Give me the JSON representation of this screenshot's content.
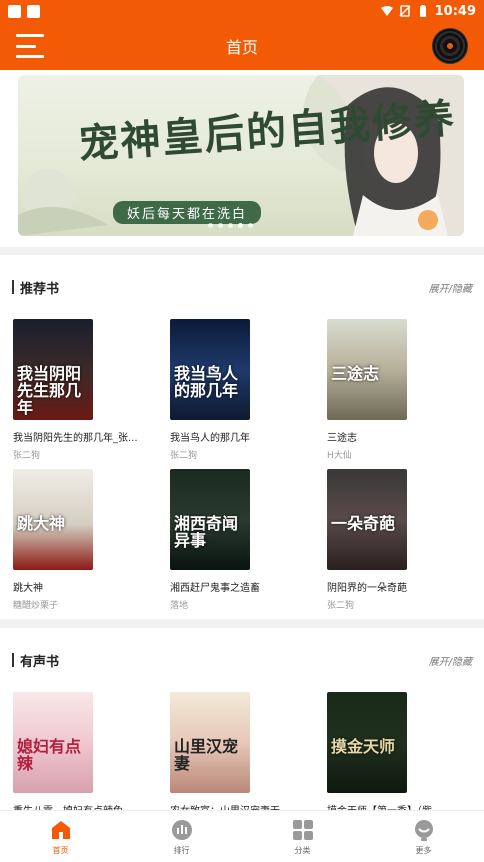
{
  "status_bar": {
    "time": "10:49"
  },
  "app_bar": {
    "title": "首页"
  },
  "banner": {
    "title": "宠神皇后的自我修养",
    "subtitle": "妖后每天都在洗白"
  },
  "sections": [
    {
      "title": "推荐书",
      "toggle": "展开/隐藏",
      "books": [
        {
          "title": "我当阴阳先生的那几年_张...",
          "author": "张二狗",
          "cover_text": "我当阴阳先生那几年"
        },
        {
          "title": "我当鸟人的那几年",
          "author": "张二狗",
          "cover_text": "我当鸟人的那几年"
        },
        {
          "title": "三途志",
          "author": "H大仙",
          "cover_text": "三途志"
        },
        {
          "title": "跳大神",
          "author": "糖醋炒栗子",
          "cover_text": "跳大神"
        },
        {
          "title": "湘西赶尸鬼事之造畜",
          "author": "落地",
          "cover_text": "湘西奇闻异事"
        },
        {
          "title": "阴阳界的一朵奇葩",
          "author": "张二狗",
          "cover_text": "一朵奇葩"
        }
      ]
    },
    {
      "title": "有声书",
      "toggle": "展开/隐藏",
      "books": [
        {
          "title": "重生八零，媳妇有点辣兔",
          "author": "",
          "cover_text": "媳妇有点辣"
        },
        {
          "title": "农女致富：山里汉宠妻无...",
          "author": "",
          "cover_text": "山里汉宠妻"
        },
        {
          "title": "摸金天师【第一季】（紫...",
          "author": "",
          "cover_text": "摸金天师"
        }
      ]
    }
  ],
  "bottom_nav": [
    {
      "label": "首页",
      "icon": "home-icon",
      "active": true
    },
    {
      "label": "排行",
      "icon": "ranking-icon",
      "active": false
    },
    {
      "label": "分类",
      "icon": "category-icon",
      "active": false
    },
    {
      "label": "更多",
      "icon": "more-icon",
      "active": false
    }
  ],
  "colors": {
    "primary": "#f25a05",
    "divider": "#f1f1f1",
    "muted": "#999999"
  }
}
